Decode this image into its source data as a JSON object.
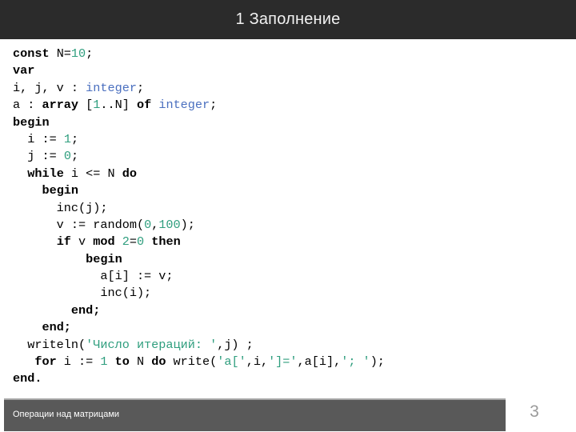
{
  "header": {
    "title": "1 Заполнение",
    "background_color": "#2b2b2b",
    "text_color": "#f2f2f2"
  },
  "code": {
    "language": "pascal",
    "colors": {
      "keyword": "#000000",
      "number": "#2f9e7e",
      "type": "#4a6fbf",
      "string": "#2f9e7e",
      "plain": "#000000"
    },
    "lines": [
      [
        {
          "t": "const",
          "c": "kw"
        },
        {
          "t": " N=",
          "c": "pl"
        },
        {
          "t": "10",
          "c": "num"
        },
        {
          "t": ";",
          "c": "pl"
        }
      ],
      [
        {
          "t": "var",
          "c": "kw"
        }
      ],
      [
        {
          "t": "i, j, v : ",
          "c": "pl"
        },
        {
          "t": "integer",
          "c": "typ"
        },
        {
          "t": ";",
          "c": "pl"
        }
      ],
      [
        {
          "t": "a : ",
          "c": "pl"
        },
        {
          "t": "array",
          "c": "kw"
        },
        {
          "t": " [",
          "c": "pl"
        },
        {
          "t": "1",
          "c": "num"
        },
        {
          "t": "..N] ",
          "c": "pl"
        },
        {
          "t": "of",
          "c": "kw"
        },
        {
          "t": " ",
          "c": "pl"
        },
        {
          "t": "integer",
          "c": "typ"
        },
        {
          "t": ";",
          "c": "pl"
        }
      ],
      [
        {
          "t": "begin",
          "c": "kw"
        }
      ],
      [
        {
          "t": "  i := ",
          "c": "pl"
        },
        {
          "t": "1",
          "c": "num"
        },
        {
          "t": ";",
          "c": "pl"
        }
      ],
      [
        {
          "t": "  j := ",
          "c": "pl"
        },
        {
          "t": "0",
          "c": "num"
        },
        {
          "t": ";",
          "c": "pl"
        }
      ],
      [
        {
          "t": "  ",
          "c": "pl"
        },
        {
          "t": "while",
          "c": "kw"
        },
        {
          "t": " i <= N ",
          "c": "pl"
        },
        {
          "t": "do",
          "c": "kw"
        }
      ],
      [
        {
          "t": "    ",
          "c": "pl"
        },
        {
          "t": "begin",
          "c": "kw"
        }
      ],
      [
        {
          "t": "      inc(j);",
          "c": "pl"
        }
      ],
      [
        {
          "t": "      v := random(",
          "c": "pl"
        },
        {
          "t": "0",
          "c": "num"
        },
        {
          "t": ",",
          "c": "pl"
        },
        {
          "t": "100",
          "c": "num"
        },
        {
          "t": ");",
          "c": "pl"
        }
      ],
      [
        {
          "t": "      ",
          "c": "pl"
        },
        {
          "t": "if",
          "c": "kw"
        },
        {
          "t": " v ",
          "c": "pl"
        },
        {
          "t": "mod",
          "c": "kw"
        },
        {
          "t": " ",
          "c": "pl"
        },
        {
          "t": "2",
          "c": "num"
        },
        {
          "t": "=",
          "c": "pl"
        },
        {
          "t": "0",
          "c": "num"
        },
        {
          "t": " ",
          "c": "pl"
        },
        {
          "t": "then",
          "c": "kw"
        }
      ],
      [
        {
          "t": "          ",
          "c": "pl"
        },
        {
          "t": "begin",
          "c": "kw"
        }
      ],
      [
        {
          "t": "            a[i] := v;",
          "c": "pl"
        }
      ],
      [
        {
          "t": "            inc(i);",
          "c": "pl"
        }
      ],
      [
        {
          "t": "        ",
          "c": "pl"
        },
        {
          "t": "end;",
          "c": "kw"
        }
      ],
      [
        {
          "t": "    ",
          "c": "pl"
        },
        {
          "t": "end;",
          "c": "kw"
        }
      ],
      [
        {
          "t": "  writeln(",
          "c": "pl"
        },
        {
          "t": "'Число итераций: '",
          "c": "str"
        },
        {
          "t": ",j) ;",
          "c": "pl"
        }
      ],
      [
        {
          "t": "   ",
          "c": "pl"
        },
        {
          "t": "for",
          "c": "kw"
        },
        {
          "t": " i := ",
          "c": "pl"
        },
        {
          "t": "1",
          "c": "num"
        },
        {
          "t": " ",
          "c": "pl"
        },
        {
          "t": "to",
          "c": "kw"
        },
        {
          "t": " N ",
          "c": "pl"
        },
        {
          "t": "do",
          "c": "kw"
        },
        {
          "t": " write(",
          "c": "pl"
        },
        {
          "t": "'a['",
          "c": "str"
        },
        {
          "t": ",i,",
          "c": "pl"
        },
        {
          "t": "']='",
          "c": "str"
        },
        {
          "t": ",a[i],",
          "c": "pl"
        },
        {
          "t": "'; '",
          "c": "str"
        },
        {
          "t": ");",
          "c": "pl"
        }
      ],
      [
        {
          "t": "end.",
          "c": "kw"
        }
      ]
    ]
  },
  "footer": {
    "text": "Операции над матрицами",
    "page_number": "3",
    "bar_color": "#595959",
    "page_number_color": "#9a9a9a"
  }
}
